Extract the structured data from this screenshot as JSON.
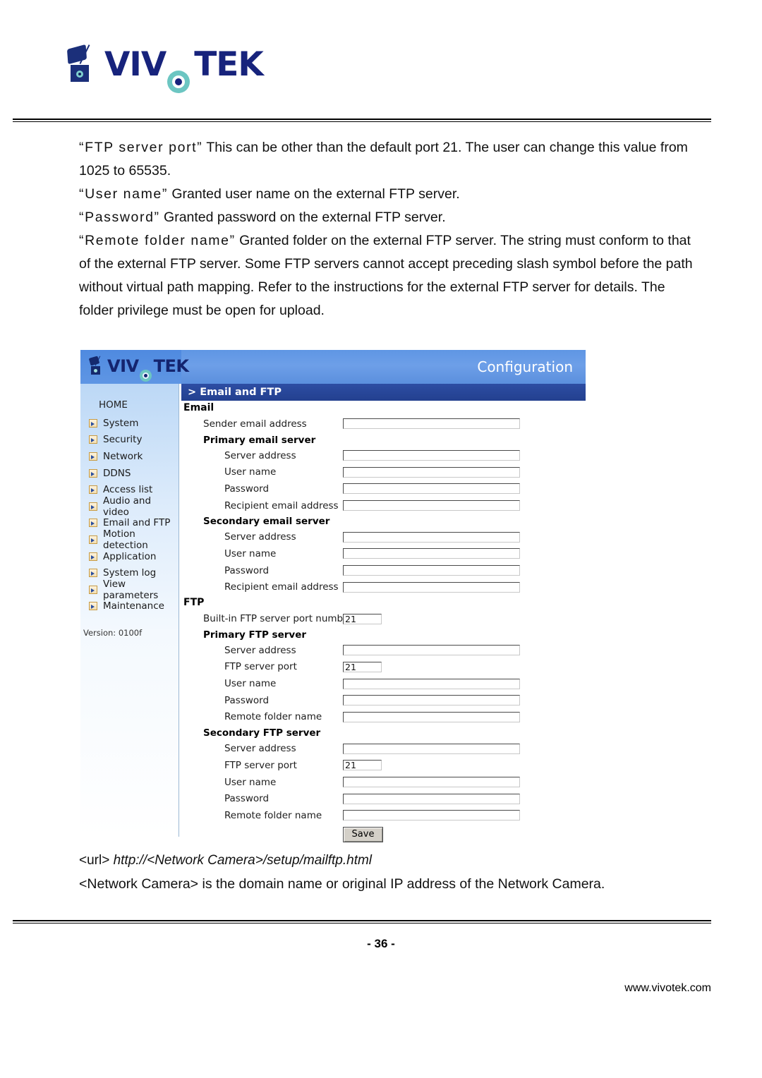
{
  "page": {
    "brand": "VIVOTEK",
    "page_number": "- 36 -",
    "website": "www.vivotek.com"
  },
  "body_text": {
    "p1_term": "“FTP server port”",
    "p1_rest": " This can be other than the default port 21. The user can change this value from 1025 to 65535.",
    "p2_term": "“User name”",
    "p2_rest": " Granted user name on the external FTP server.",
    "p3_term": "“Password”",
    "p3_rest": " Granted password on the external FTP server.",
    "p4_term": "“Remote folder name”",
    "p4_rest": " Granted folder on the external FTP server. The string must conform to that of the external FTP server. Some FTP servers cannot accept preceding slash symbol before the path without virtual path mapping. Refer to the instructions for the external FTP server for details. The folder privilege must be open for upload."
  },
  "url_note": {
    "tag": "<url>",
    "url": " http://<Network Camera>/setup/mailftp.html",
    "explain": "<Network Camera> is the domain name or original IP address of the Network Camera."
  },
  "screenshot": {
    "banner": {
      "brand": "VIVOTEK",
      "title": "Configuration"
    },
    "breadcrumb": "> Email and FTP",
    "sidebar": {
      "home": "HOME",
      "items": [
        {
          "label": "System",
          "icon": "arrow-square-icon"
        },
        {
          "label": "Security",
          "icon": "arrow-square-icon"
        },
        {
          "label": "Network",
          "icon": "arrow-square-icon"
        },
        {
          "label": "DDNS",
          "icon": "arrow-square-icon"
        },
        {
          "label": "Access list",
          "icon": "arrow-square-icon"
        },
        {
          "label": "Audio and video",
          "icon": "arrow-square-icon"
        },
        {
          "label": "Email and FTP",
          "icon": "arrow-square-icon"
        },
        {
          "label": "Motion detection",
          "icon": "arrow-square-icon"
        },
        {
          "label": "Application",
          "icon": "arrow-square-icon"
        },
        {
          "label": "System log",
          "icon": "arrow-square-icon"
        },
        {
          "label": "View parameters",
          "icon": "arrow-square-icon"
        },
        {
          "label": "Maintenance",
          "icon": "arrow-square-icon"
        }
      ],
      "version": "Version: 0100f"
    },
    "form": {
      "email_section": "Email",
      "sender_email_label": "Sender email address",
      "sender_email_value": "",
      "primary_email_server": "Primary email server",
      "secondary_email_server": "Secondary email server",
      "server_address_label": "Server address",
      "user_name_label": "User name",
      "password_label": "Password",
      "recipient_email_label": "Recipient email address",
      "primary_email_values": {
        "server_address": "",
        "user_name": "",
        "password": "",
        "recipient": ""
      },
      "secondary_email_values": {
        "server_address": "",
        "user_name": "",
        "password": "",
        "recipient": ""
      },
      "ftp_section": "FTP",
      "builtin_port_label": "Built-in FTP server port number",
      "builtin_port_value": "21",
      "primary_ftp_server": "Primary FTP server",
      "secondary_ftp_server": "Secondary FTP server",
      "ftp_server_port_label": "FTP server port",
      "remote_folder_label": "Remote folder name",
      "primary_ftp_values": {
        "server_address": "",
        "ftp_server_port": "21",
        "user_name": "",
        "password": "",
        "remote_folder": ""
      },
      "secondary_ftp_values": {
        "server_address": "",
        "ftp_server_port": "21",
        "user_name": "",
        "password": "",
        "remote_folder": ""
      },
      "save_label": "Save"
    }
  },
  "colors": {
    "banner_blue": "#5f96e4",
    "breadcrumb_blue": "#2d4da3",
    "brand_navy": "#17237c",
    "lens_teal": "#6cc6c2",
    "icon_gold": "#c79a43"
  }
}
